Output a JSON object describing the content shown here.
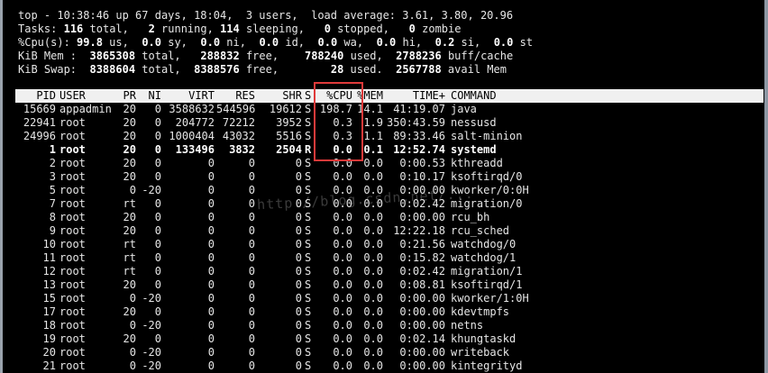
{
  "summary": {
    "line1_text": "top - 10:38:46 up 67 days, 18:04,  3 users,  load average: 3.61, 3.80, 20.96",
    "tasks_label": "Tasks:",
    "tasks_total": "116",
    "tasks_total_label": "total,",
    "tasks_running": "2",
    "tasks_running_label": "running,",
    "tasks_sleeping": "114",
    "tasks_sleeping_label": "sleeping,",
    "tasks_stopped": "0",
    "tasks_stopped_label": "stopped,",
    "tasks_zombie": "0",
    "tasks_zombie_label": "zombie",
    "cpu_label": "%Cpu(s):",
    "cpu_us": "99.8",
    "cpu_us_label": "us,",
    "cpu_sy": "0.0",
    "cpu_sy_label": "sy,",
    "cpu_ni": "0.0",
    "cpu_ni_label": "ni,",
    "cpu_id": "0.0",
    "cpu_id_label": "id,",
    "cpu_wa": "0.0",
    "cpu_wa_label": "wa,",
    "cpu_hi": "0.0",
    "cpu_hi_label": "hi,",
    "cpu_si": "0.2",
    "cpu_si_label": "si,",
    "cpu_st": "0.0",
    "cpu_st_label": "st",
    "mem_label": "KiB Mem :",
    "mem_total": "3865308",
    "mem_total_label": "total,",
    "mem_free": "288832",
    "mem_free_label": "free,",
    "mem_used": "788240",
    "mem_used_label": "used,",
    "mem_cache": "2788236",
    "mem_cache_label": "buff/cache",
    "swap_label": "KiB Swap:",
    "swap_total": "8388604",
    "swap_total_label": "total,",
    "swap_free": "8388576",
    "swap_free_label": "free,",
    "swap_used": "28",
    "swap_used_label": "used.",
    "swap_avail": "2567788",
    "swap_avail_label": "avail Mem"
  },
  "columns": {
    "pid": "PID",
    "user": "USER",
    "pr": "PR",
    "ni": "NI",
    "virt": "VIRT",
    "res": "RES",
    "shr": "SHR",
    "s": "S",
    "cpu": "%CPU",
    "mem": "%MEM",
    "time": "TIME+",
    "command": "COMMAND"
  },
  "processes": [
    {
      "pid": "15669",
      "user": "appadmin",
      "pr": "20",
      "ni": "0",
      "virt": "3588632",
      "res": "544596",
      "shr": "19612",
      "s": "S",
      "cpu": "198.7",
      "mem": "14.1",
      "time": "41:19.07",
      "command": "java"
    },
    {
      "pid": "22941",
      "user": "root",
      "pr": "20",
      "ni": "0",
      "virt": "204772",
      "res": "72212",
      "shr": "3952",
      "s": "S",
      "cpu": "0.3",
      "mem": "1.9",
      "time": "350:43.59",
      "command": "nessusd"
    },
    {
      "pid": "24996",
      "user": "root",
      "pr": "20",
      "ni": "0",
      "virt": "1000404",
      "res": "43032",
      "shr": "5516",
      "s": "S",
      "cpu": "0.3",
      "mem": "1.1",
      "time": "89:33.46",
      "command": "salt-minion"
    },
    {
      "pid": "1",
      "user": "root",
      "pr": "20",
      "ni": "0",
      "virt": "133496",
      "res": "3832",
      "shr": "2504",
      "s": "R",
      "cpu": "0.0",
      "mem": "0.1",
      "time": "12:52.74",
      "command": "systemd"
    },
    {
      "pid": "2",
      "user": "root",
      "pr": "20",
      "ni": "0",
      "virt": "0",
      "res": "0",
      "shr": "0",
      "s": "S",
      "cpu": "0.0",
      "mem": "0.0",
      "time": "0:00.53",
      "command": "kthreadd"
    },
    {
      "pid": "3",
      "user": "root",
      "pr": "20",
      "ni": "0",
      "virt": "0",
      "res": "0",
      "shr": "0",
      "s": "S",
      "cpu": "0.0",
      "mem": "0.0",
      "time": "0:10.17",
      "command": "ksoftirqd/0"
    },
    {
      "pid": "5",
      "user": "root",
      "pr": "0",
      "ni": "-20",
      "virt": "0",
      "res": "0",
      "shr": "0",
      "s": "S",
      "cpu": "0.0",
      "mem": "0.0",
      "time": "0:00.00",
      "command": "kworker/0:0H"
    },
    {
      "pid": "7",
      "user": "root",
      "pr": "rt",
      "ni": "0",
      "virt": "0",
      "res": "0",
      "shr": "0",
      "s": "S",
      "cpu": "0.0",
      "mem": "0.0",
      "time": "0:02.42",
      "command": "migration/0"
    },
    {
      "pid": "8",
      "user": "root",
      "pr": "20",
      "ni": "0",
      "virt": "0",
      "res": "0",
      "shr": "0",
      "s": "S",
      "cpu": "0.0",
      "mem": "0.0",
      "time": "0:00.00",
      "command": "rcu_bh"
    },
    {
      "pid": "9",
      "user": "root",
      "pr": "20",
      "ni": "0",
      "virt": "0",
      "res": "0",
      "shr": "0",
      "s": "S",
      "cpu": "0.0",
      "mem": "0.0",
      "time": "12:22.18",
      "command": "rcu_sched"
    },
    {
      "pid": "10",
      "user": "root",
      "pr": "rt",
      "ni": "0",
      "virt": "0",
      "res": "0",
      "shr": "0",
      "s": "S",
      "cpu": "0.0",
      "mem": "0.0",
      "time": "0:21.56",
      "command": "watchdog/0"
    },
    {
      "pid": "11",
      "user": "root",
      "pr": "rt",
      "ni": "0",
      "virt": "0",
      "res": "0",
      "shr": "0",
      "s": "S",
      "cpu": "0.0",
      "mem": "0.0",
      "time": "0:15.82",
      "command": "watchdog/1"
    },
    {
      "pid": "12",
      "user": "root",
      "pr": "rt",
      "ni": "0",
      "virt": "0",
      "res": "0",
      "shr": "0",
      "s": "S",
      "cpu": "0.0",
      "mem": "0.0",
      "time": "0:02.42",
      "command": "migration/1"
    },
    {
      "pid": "13",
      "user": "root",
      "pr": "20",
      "ni": "0",
      "virt": "0",
      "res": "0",
      "shr": "0",
      "s": "S",
      "cpu": "0.0",
      "mem": "0.0",
      "time": "0:08.81",
      "command": "ksoftirqd/1"
    },
    {
      "pid": "15",
      "user": "root",
      "pr": "0",
      "ni": "-20",
      "virt": "0",
      "res": "0",
      "shr": "0",
      "s": "S",
      "cpu": "0.0",
      "mem": "0.0",
      "time": "0:00.00",
      "command": "kworker/1:0H"
    },
    {
      "pid": "17",
      "user": "root",
      "pr": "20",
      "ni": "0",
      "virt": "0",
      "res": "0",
      "shr": "0",
      "s": "S",
      "cpu": "0.0",
      "mem": "0.0",
      "time": "0:00.00",
      "command": "kdevtmpfs"
    },
    {
      "pid": "18",
      "user": "root",
      "pr": "0",
      "ni": "-20",
      "virt": "0",
      "res": "0",
      "shr": "0",
      "s": "S",
      "cpu": "0.0",
      "mem": "0.0",
      "time": "0:00.00",
      "command": "netns"
    },
    {
      "pid": "19",
      "user": "root",
      "pr": "20",
      "ni": "0",
      "virt": "0",
      "res": "0",
      "shr": "0",
      "s": "S",
      "cpu": "0.0",
      "mem": "0.0",
      "time": "0:02.14",
      "command": "khungtaskd"
    },
    {
      "pid": "20",
      "user": "root",
      "pr": "0",
      "ni": "-20",
      "virt": "0",
      "res": "0",
      "shr": "0",
      "s": "S",
      "cpu": "0.0",
      "mem": "0.0",
      "time": "0:00.00",
      "command": "writeback"
    },
    {
      "pid": "21",
      "user": "root",
      "pr": "0",
      "ni": "-20",
      "virt": "0",
      "res": "0",
      "shr": "0",
      "s": "S",
      "cpu": "0.0",
      "mem": "0.0",
      "time": "0:00.00",
      "command": "kintegrityd"
    }
  ],
  "watermark": "http://blog.csdn.net/...",
  "colors": {
    "background": "#000000",
    "text": "#e6e6e6",
    "header_bar": "#f0f0f0",
    "highlight_box": "#e03a3a"
  }
}
